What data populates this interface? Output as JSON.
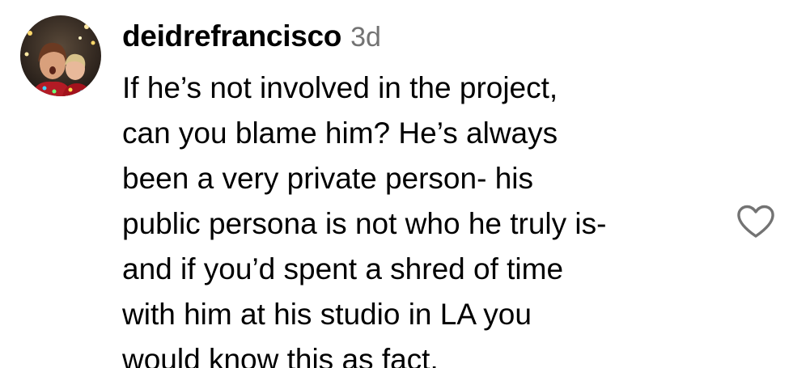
{
  "comment": {
    "username": "deidrefrancisco",
    "timestamp": "3d",
    "text_lines": [
      "If he’s not involved in the project,",
      "can you blame him? He’s always",
      "been a very private person- his",
      "public persona is not who he truly is-",
      "and if you’d spent a shred of time",
      "with him at his studio in LA you",
      "would know this as fact."
    ],
    "avatar_icon": "profile-photo-icon",
    "like_icon": "heart-outline-icon"
  },
  "colors": {
    "text": "#000000",
    "timestamp": "#737373",
    "heart_stroke": "#737373",
    "background": "#ffffff"
  }
}
